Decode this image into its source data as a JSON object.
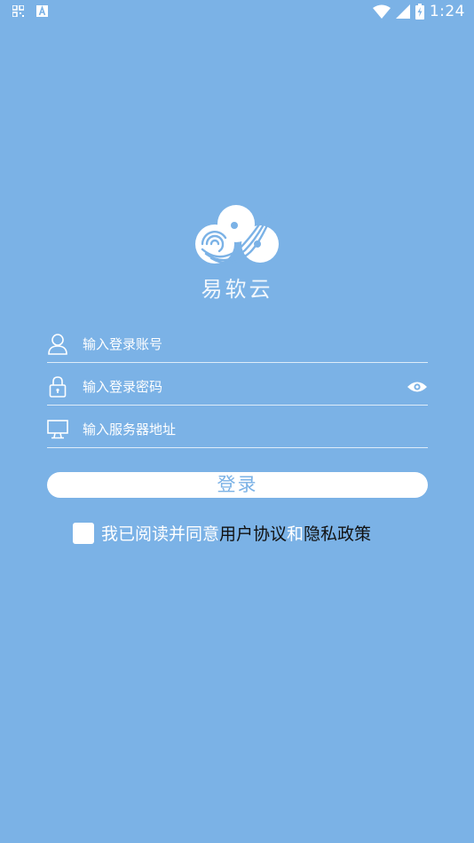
{
  "status_bar": {
    "time": "1:24",
    "left_icons": [
      "qr-grid-icon",
      "text-a-icon"
    ],
    "right_icons": [
      "wifi-icon",
      "cell-signal-icon",
      "battery-charging-icon"
    ]
  },
  "logo": {
    "icon": "cloud-logo-icon",
    "app_name": "易软云"
  },
  "form": {
    "account_placeholder": "输入登录账号",
    "password_placeholder": "输入登录密码",
    "server_placeholder": "输入服务器地址",
    "account_icon": "user-icon",
    "password_icon": "lock-icon",
    "server_icon": "monitor-icon",
    "show_password_icon": "eye-icon"
  },
  "login_label": "登录",
  "agreement": {
    "checked": false,
    "prefix": "我已阅读并同意",
    "user_agreement": "用户协议",
    "joiner": "和",
    "privacy_policy": "隐私政策"
  },
  "colors": {
    "background": "#7bb2e6",
    "button_bg": "#ffffff",
    "button_text": "#7bb2e6",
    "link_text": "#111111"
  }
}
